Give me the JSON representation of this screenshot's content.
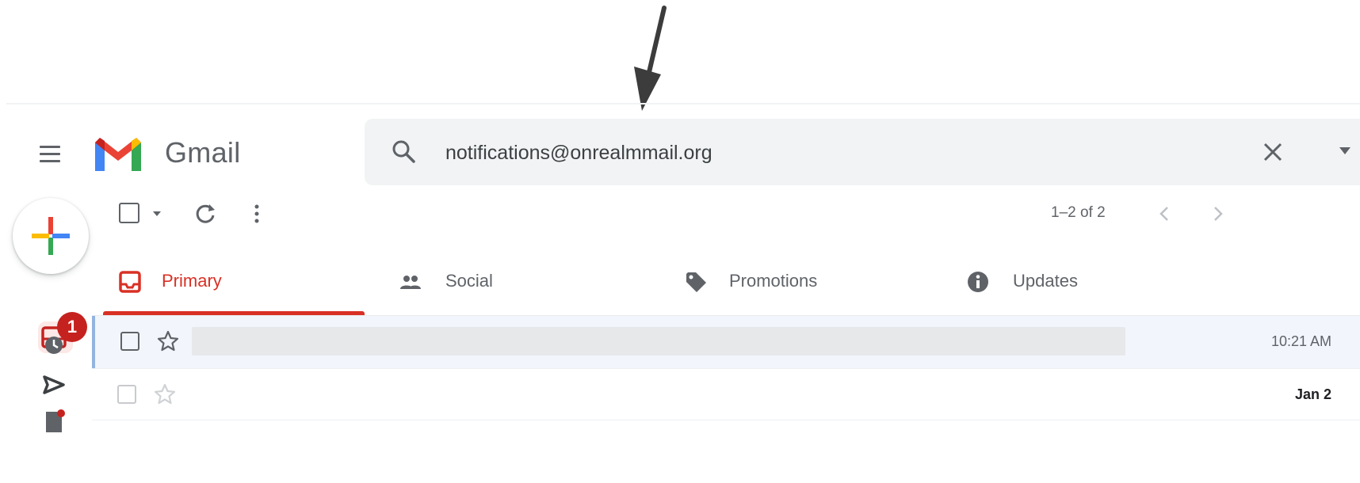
{
  "header": {
    "app_name": "Gmail",
    "menu_icon": "hamburger-menu-icon",
    "logo_icon": "gmail-m-logo-icon"
  },
  "search": {
    "icon": "search-icon",
    "value": "notifications@onrealmmail.org",
    "clear_icon": "close-icon",
    "options_icon": "caret-down-icon"
  },
  "rail": {
    "compose_icon": "compose-plus-icon",
    "inbox_icon": "inbox-icon",
    "inbox_badge": "1",
    "items": [
      "snoozed-clock-icon",
      "sent-icon",
      "drafts-icon"
    ]
  },
  "toolbar": {
    "select_icon": "checkbox-icon",
    "select_menu_icon": "caret-down-icon",
    "refresh_icon": "refresh-icon",
    "more_icon": "more-vert-icon",
    "pagination": "1–2 of 2",
    "prev_icon": "chevron-left-icon",
    "next_icon": "chevron-right-icon"
  },
  "tabs": [
    {
      "label": "Primary",
      "icon": "inbox-icon",
      "active": true
    },
    {
      "label": "Social",
      "icon": "people-icon",
      "active": false
    },
    {
      "label": "Promotions",
      "icon": "tag-icon",
      "active": false
    },
    {
      "label": "Updates",
      "icon": "info-icon",
      "active": false
    }
  ],
  "messages": [
    {
      "date": "10:21 AM",
      "unread": false
    },
    {
      "date": "Jan 2",
      "unread": true
    }
  ],
  "colors": {
    "accent_red": "#d93025",
    "search_bg": "#f1f3f4",
    "selected_row": "#f2f6fc",
    "badge": "#c5221f"
  }
}
